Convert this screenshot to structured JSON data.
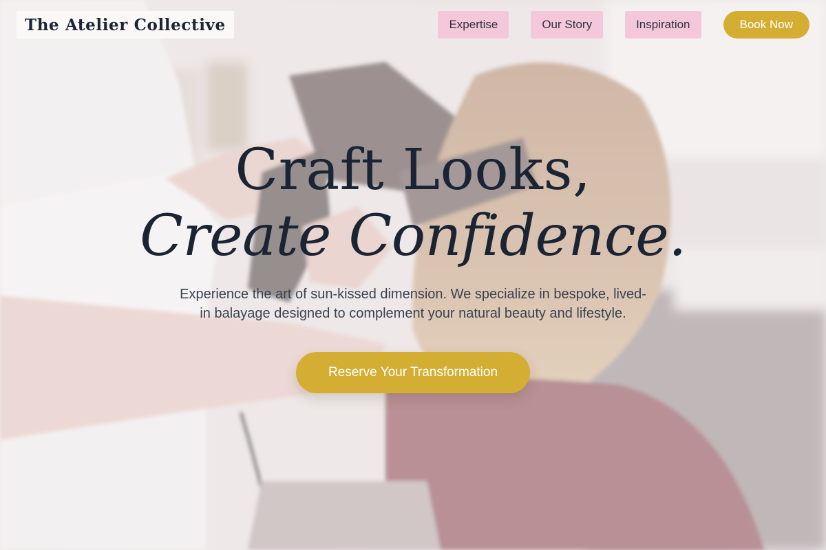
{
  "brand": {
    "name": "The Atelier Collective"
  },
  "nav": {
    "items": [
      {
        "label": "Expertise"
      },
      {
        "label": "Our Story"
      },
      {
        "label": "Inspiration"
      }
    ],
    "cta_label": "Book Now"
  },
  "hero": {
    "headline_line1": "Craft Looks,",
    "headline_line2": "Create Confidence.",
    "subtitle": "Experience the art of sun-kissed dimension. We specialize in bespoke, lived-in balayage designed to complement your natural beauty and lifestyle.",
    "cta_label": "Reserve Your Transformation"
  },
  "colors": {
    "accent_gold": "#d4ae33",
    "nav_pink": "#f4c7da",
    "text_dark": "#1b2533"
  }
}
